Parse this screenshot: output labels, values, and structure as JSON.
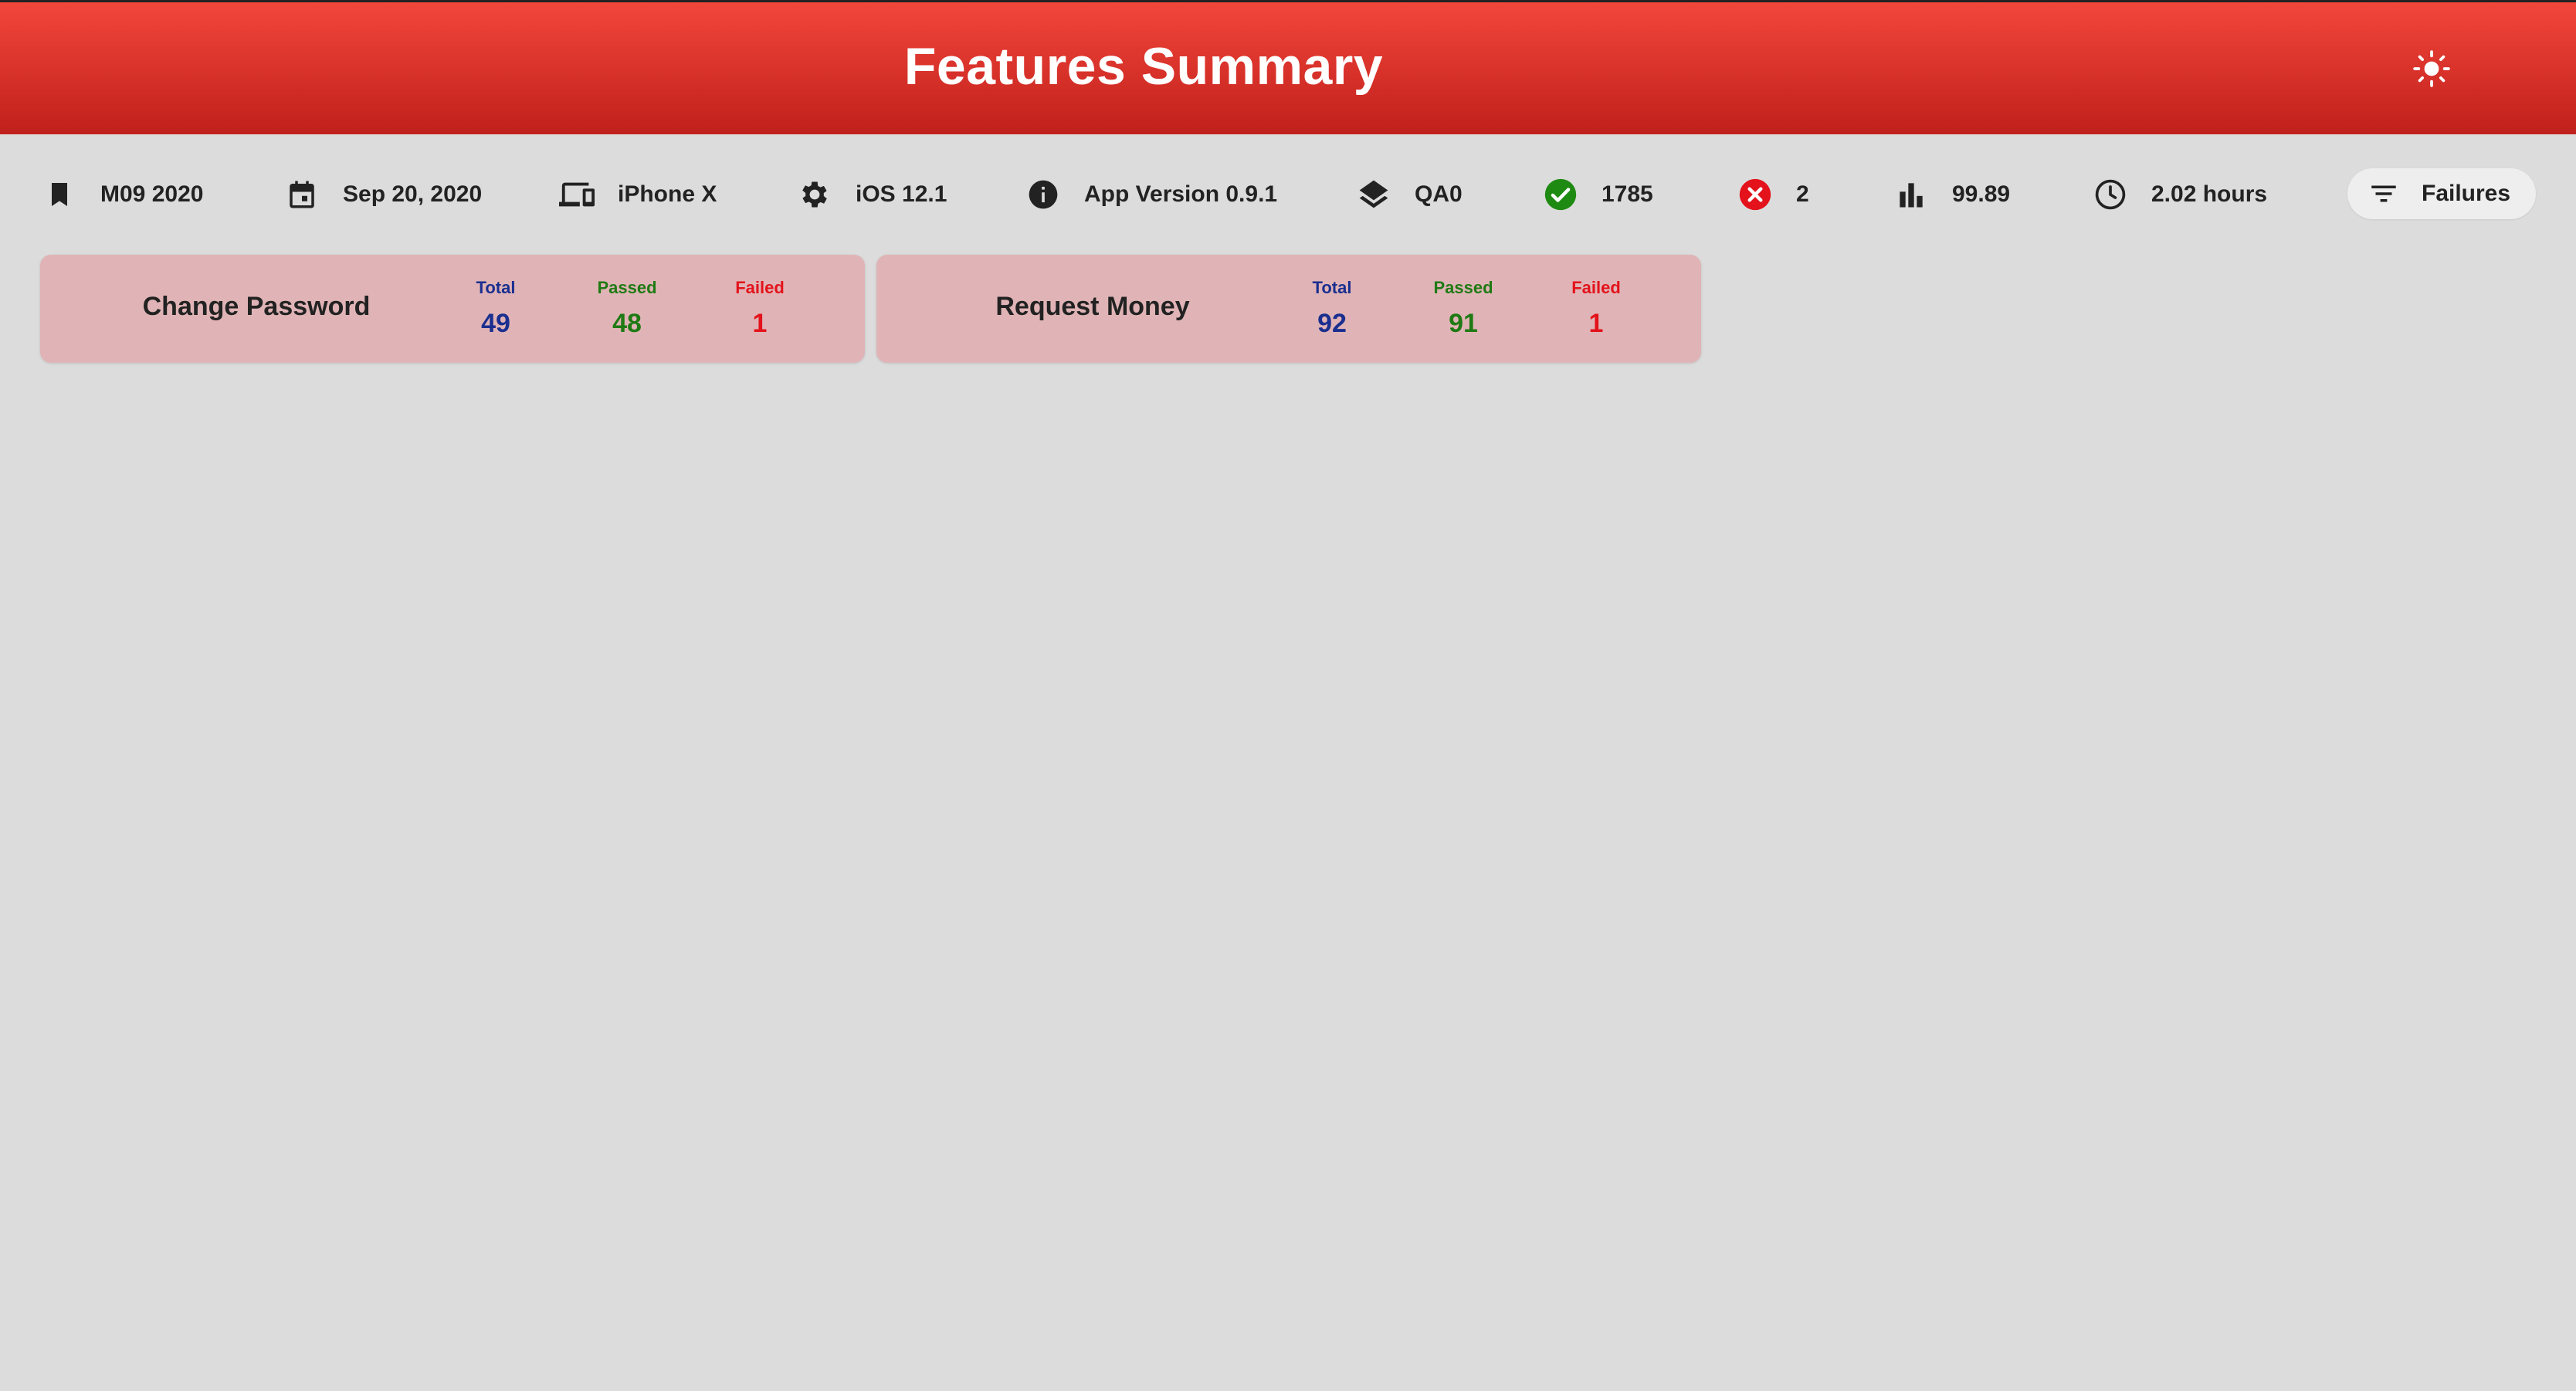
{
  "header": {
    "title": "Features Summary",
    "theme_icon": "sun-icon"
  },
  "toolbar": {
    "items": [
      {
        "icon": "bookmark-icon",
        "text": "M09 2020"
      },
      {
        "icon": "calendar-icon",
        "text": "Sep 20, 2020"
      },
      {
        "icon": "devices-icon",
        "text": "iPhone X"
      },
      {
        "icon": "gear-icon",
        "text": "iOS 12.1"
      },
      {
        "icon": "info-icon",
        "text": "App Version 0.9.1"
      },
      {
        "icon": "layers-icon",
        "text": "QA0"
      },
      {
        "icon": "check-circle-icon",
        "text": "1785"
      },
      {
        "icon": "error-circle-icon",
        "text": "2"
      },
      {
        "icon": "bar-chart-icon",
        "text": "99.89"
      },
      {
        "icon": "clock-icon",
        "text": "2.02 hours"
      }
    ],
    "filter": {
      "icon": "filter-icon",
      "label": "Failures"
    }
  },
  "colors": {
    "header_top": "#f2463b",
    "header_bottom": "#c0201b",
    "card_bg": "#e0b4b6",
    "total": "#1a2f8f",
    "passed": "#1f7a14",
    "failed": "#e3121b",
    "check": "#1f8a12",
    "error": "#e3121b"
  },
  "features": [
    {
      "name": "Change Password",
      "total_label": "Total",
      "total": "49",
      "passed_label": "Passed",
      "passed": "48",
      "failed_label": "Failed",
      "failed": "1"
    },
    {
      "name": "Request Money",
      "total_label": "Total",
      "total": "92",
      "passed_label": "Passed",
      "passed": "91",
      "failed_label": "Failed",
      "failed": "1"
    }
  ]
}
